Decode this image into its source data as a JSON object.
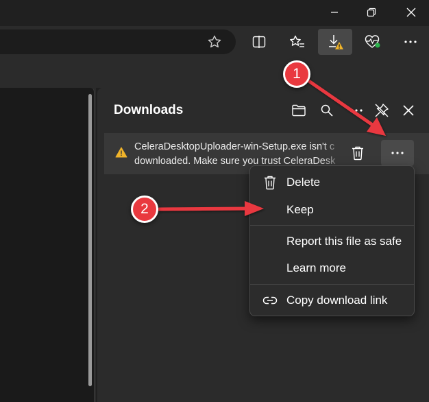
{
  "window": {
    "minimize_icon": "minimize-icon",
    "maximize_icon": "restore-icon",
    "close_icon": "close-icon"
  },
  "toolbar": {
    "favorite_icon": "star-icon",
    "split_icon": "split-screen-icon",
    "favorites_icon": "favorites-icon",
    "downloads_icon": "download-warning-icon",
    "health_icon": "browser-essentials-icon",
    "more_icon": "more-icon"
  },
  "downloads": {
    "title": "Downloads",
    "item": {
      "line1": "CeleraDesktopUploader-win-Setup.exe isn't c",
      "line2": "downloaded. Make sure you trust CeleraDesk"
    }
  },
  "menu": {
    "items": [
      {
        "label": "Delete",
        "icon": "trash-icon"
      },
      {
        "label": "Keep",
        "icon": ""
      },
      {
        "label": "Report this file as safe",
        "icon": ""
      },
      {
        "label": "Learn more",
        "icon": ""
      },
      {
        "label": "Copy download link",
        "icon": "link-icon"
      }
    ]
  },
  "annotations": {
    "badge1": "1",
    "badge2": "2"
  },
  "colors": {
    "accent_red": "#e9393f",
    "warning": "#f0b42a",
    "panel_bg": "#2b2b2b",
    "menu_bg": "#2c2c2c"
  }
}
